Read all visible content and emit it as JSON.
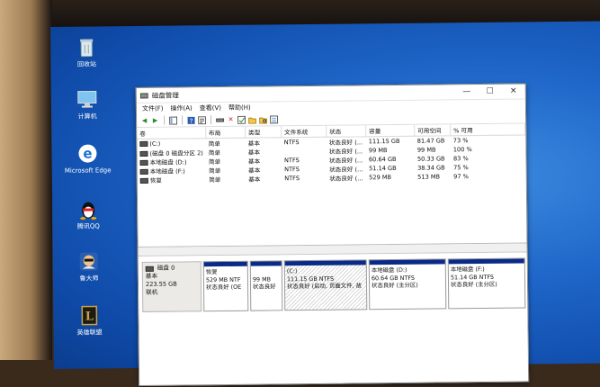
{
  "desktop_icons": [
    {
      "label": "回收站",
      "icon": "recycle-bin-icon"
    },
    {
      "label": "计算机",
      "icon": "computer-icon"
    },
    {
      "label": "Microsoft Edge",
      "icon": "edge-icon"
    },
    {
      "label": "腾讯QQ",
      "icon": "qq-penguin-icon"
    },
    {
      "label": "鲁大师",
      "icon": "ludashi-icon"
    },
    {
      "label": "英雄联盟",
      "icon": "league-icon"
    }
  ],
  "window": {
    "title": "磁盘管理",
    "controls": {
      "minimize": "—",
      "maximize": "☐",
      "close": "✕"
    }
  },
  "menu": [
    "文件(F)",
    "操作(A)",
    "查看(V)",
    "帮助(H)"
  ],
  "volume_table": {
    "columns": [
      "卷",
      "布局",
      "类型",
      "文件系统",
      "状态",
      "容量",
      "可用空间",
      "% 可用"
    ],
    "rows": [
      [
        "(C:)",
        "简单",
        "基本",
        "NTFS",
        "状态良好 (...",
        "111.15 GB",
        "81.47 GB",
        "73 %"
      ],
      [
        "(磁盘 0 磁盘分区 2)",
        "简单",
        "基本",
        "",
        "状态良好 (...",
        "99 MB",
        "99 MB",
        "100 %"
      ],
      [
        "本地磁盘 (D:)",
        "简单",
        "基本",
        "NTFS",
        "状态良好 (...",
        "60.64 GB",
        "50.33 GB",
        "83 %"
      ],
      [
        "本地磁盘 (F:)",
        "简单",
        "基本",
        "NTFS",
        "状态良好 (...",
        "51.14 GB",
        "38.34 GB",
        "75 %"
      ],
      [
        "恢复",
        "简单",
        "基本",
        "NTFS",
        "状态良好 (...",
        "529 MB",
        "513 MB",
        "97 %"
      ]
    ]
  },
  "disk": {
    "name": "磁盘 0",
    "type": "基本",
    "size": "223.55 GB",
    "status": "联机",
    "partitions": [
      {
        "name": "恢复",
        "line1": "529 MB NTF",
        "line2": "状态良好 (OE"
      },
      {
        "name": "",
        "line1": "99 MB",
        "line2": "状态良好"
      },
      {
        "name": "(C:)",
        "line1": "111.15 GB NTFS",
        "line2": "状态良好 (启动, 页面文件, 故"
      },
      {
        "name": "本地磁盘 (D:)",
        "line1": "60.64 GB NTFS",
        "line2": "状态良好 (主分区)"
      },
      {
        "name": "本地磁盘 (F:)",
        "line1": "51.14 GB NTFS",
        "line2": "状态良好 (主分区)"
      }
    ]
  },
  "colors": {
    "partition_bar": "#0a2a88",
    "desktop_blue": "#1e66c8"
  }
}
